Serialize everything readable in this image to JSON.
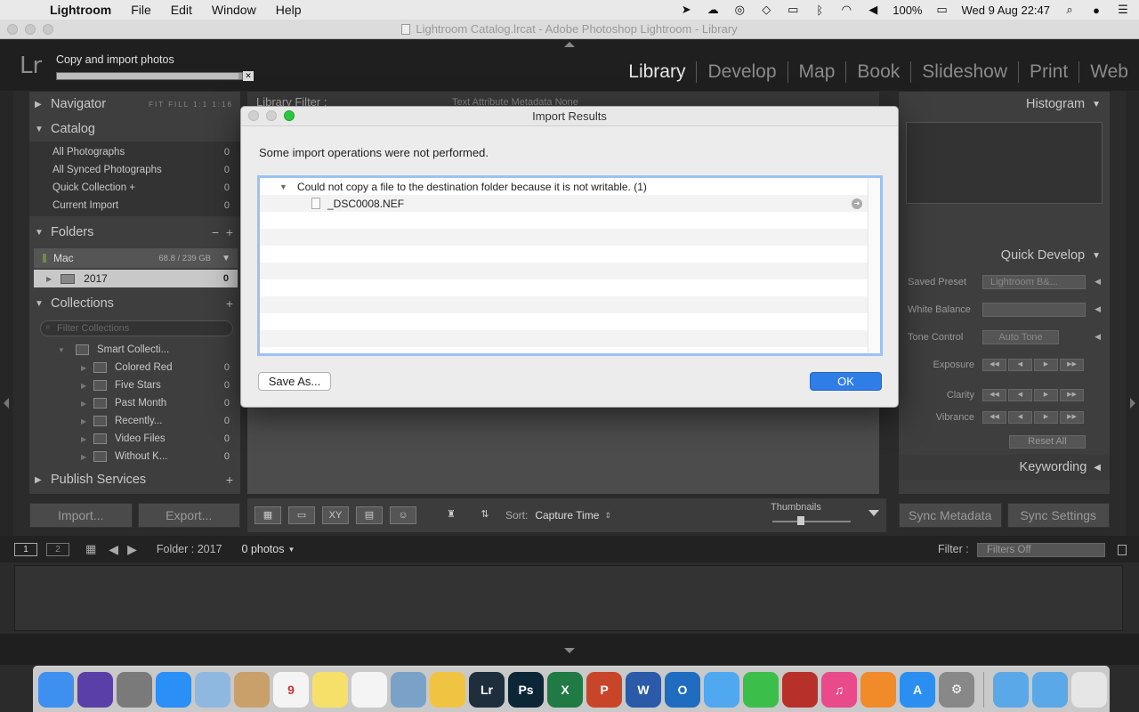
{
  "menubar": {
    "app": "Lightroom",
    "items": [
      "File",
      "Edit",
      "Window",
      "Help"
    ],
    "battery": "100%",
    "datetime": "Wed 9 Aug  22:47"
  },
  "window": {
    "title": "Lightroom Catalog.lrcat - Adobe Photoshop Lightroom - Library"
  },
  "lr_header": {
    "logo": "Lr",
    "progress_label": "Copy and import photos",
    "progress_fraction": 0.98,
    "modules": [
      "Library",
      "Develop",
      "Map",
      "Book",
      "Slideshow",
      "Print",
      "Web"
    ],
    "active_module": "Library"
  },
  "left_panel": {
    "navigator": {
      "title": "Navigator",
      "modes": "FIT  FILL  1:1  1:16"
    },
    "catalog": {
      "title": "Catalog",
      "items": [
        {
          "label": "All Photographs",
          "count": "0"
        },
        {
          "label": "All Synced Photographs",
          "count": "0"
        },
        {
          "label": "Quick Collection  +",
          "count": "0"
        },
        {
          "label": "Current Import",
          "count": "0"
        }
      ]
    },
    "folders": {
      "title": "Folders",
      "volume": {
        "name": "Mac",
        "size": "68.8 / 239 GB"
      },
      "folder": {
        "name": "2017",
        "count": "0"
      }
    },
    "collections": {
      "title": "Collections",
      "filter_placeholder": "Filter Collections",
      "smart_set": "Smart Collecti...",
      "items": [
        {
          "label": "Colored Red",
          "count": "0"
        },
        {
          "label": "Five Stars",
          "count": "0"
        },
        {
          "label": "Past Month",
          "count": "0"
        },
        {
          "label": "Recently...",
          "count": "0"
        },
        {
          "label": "Video Files",
          "count": "0"
        },
        {
          "label": "Without K...",
          "count": "0"
        }
      ]
    },
    "publish": {
      "title": "Publish Services"
    },
    "import_label": "Import...",
    "export_label": "Export..."
  },
  "center": {
    "library_filter": "Library Filter :",
    "filter_options": "Text   Attribute   Metadata   None",
    "sort_label": "Sort:",
    "sort_value": "Capture Time",
    "thumbnails_label": "Thumbnails"
  },
  "right_panel": {
    "histogram": "Histogram",
    "quick_develop": "Quick Develop",
    "saved_preset_label": "Saved Preset",
    "saved_preset_value": "Lightroom B&...",
    "white_balance_label": "White Balance",
    "tone_control_label": "Tone Control",
    "auto_tone": "Auto Tone",
    "exposure_label": "Exposure",
    "clarity_label": "Clarity",
    "vibrance_label": "Vibrance",
    "reset_all": "Reset All",
    "keywording": "Keywording",
    "sync_metadata": "Sync Metadata",
    "sync_settings": "Sync Settings"
  },
  "filmstrip": {
    "screen1": "1",
    "screen2": "2",
    "folder_label": "Folder : 2017",
    "photos": "0 photos",
    "filter_label": "Filter :",
    "filter_value": "Filters Off"
  },
  "dialog": {
    "title": "Import Results",
    "message": "Some import operations were not performed.",
    "error_group": "Could not copy a file to the destination folder because it is not writable. (1)",
    "file": "_DSC0008.NEF",
    "save_as": "Save As...",
    "ok": "OK"
  },
  "dock": {
    "apps": [
      {
        "name": "finder-icon",
        "color": "#3d8ff0",
        "glyph": ""
      },
      {
        "name": "siri-icon",
        "color": "#5b3fa8",
        "glyph": ""
      },
      {
        "name": "launchpad-icon",
        "color": "#7a7a7a",
        "glyph": ""
      },
      {
        "name": "safari-icon",
        "color": "#2a8ff7",
        "glyph": ""
      },
      {
        "name": "preview-icon",
        "color": "#8fb8e0",
        "glyph": ""
      },
      {
        "name": "contacts-icon",
        "color": "#c9a06a",
        "glyph": ""
      },
      {
        "name": "calendar-icon",
        "color": "#f4f4f4",
        "glyph": "9"
      },
      {
        "name": "notes-icon",
        "color": "#f7e06a",
        "glyph": ""
      },
      {
        "name": "reminders-icon",
        "color": "#f4f4f4",
        "glyph": ""
      },
      {
        "name": "image-capture-icon",
        "color": "#7aa2c8",
        "glyph": ""
      },
      {
        "name": "photos-icon",
        "color": "#f1c343",
        "glyph": ""
      },
      {
        "name": "lightroom-icon",
        "color": "#1f2e3d",
        "glyph": "Lr"
      },
      {
        "name": "photoshop-icon",
        "color": "#0c2637",
        "glyph": "Ps"
      },
      {
        "name": "excel-icon",
        "color": "#1f7a43",
        "glyph": "X"
      },
      {
        "name": "powerpoint-icon",
        "color": "#c9452a",
        "glyph": "P"
      },
      {
        "name": "word-icon",
        "color": "#2a5aa8",
        "glyph": "W"
      },
      {
        "name": "outlook-icon",
        "color": "#1f6cc0",
        "glyph": "O"
      },
      {
        "name": "messages-icon",
        "color": "#4fa8f0",
        "glyph": ""
      },
      {
        "name": "facetime-icon",
        "color": "#3cbf4a",
        "glyph": ""
      },
      {
        "name": "photo-booth-icon",
        "color": "#b8302a",
        "glyph": ""
      },
      {
        "name": "itunes-icon",
        "color": "#e84a8a",
        "glyph": "♫"
      },
      {
        "name": "ibooks-icon",
        "color": "#f18b2a",
        "glyph": ""
      },
      {
        "name": "app-store-icon",
        "color": "#2a8ff0",
        "glyph": "A"
      },
      {
        "name": "system-preferences-icon",
        "color": "#888888",
        "glyph": "⚙"
      }
    ],
    "trailing": [
      {
        "name": "folder-icon",
        "color": "#5aa8e8",
        "glyph": ""
      },
      {
        "name": "downloads-folder-icon",
        "color": "#5aa8e8",
        "glyph": ""
      },
      {
        "name": "trash-icon",
        "color": "#e6e6e6",
        "glyph": ""
      }
    ]
  }
}
